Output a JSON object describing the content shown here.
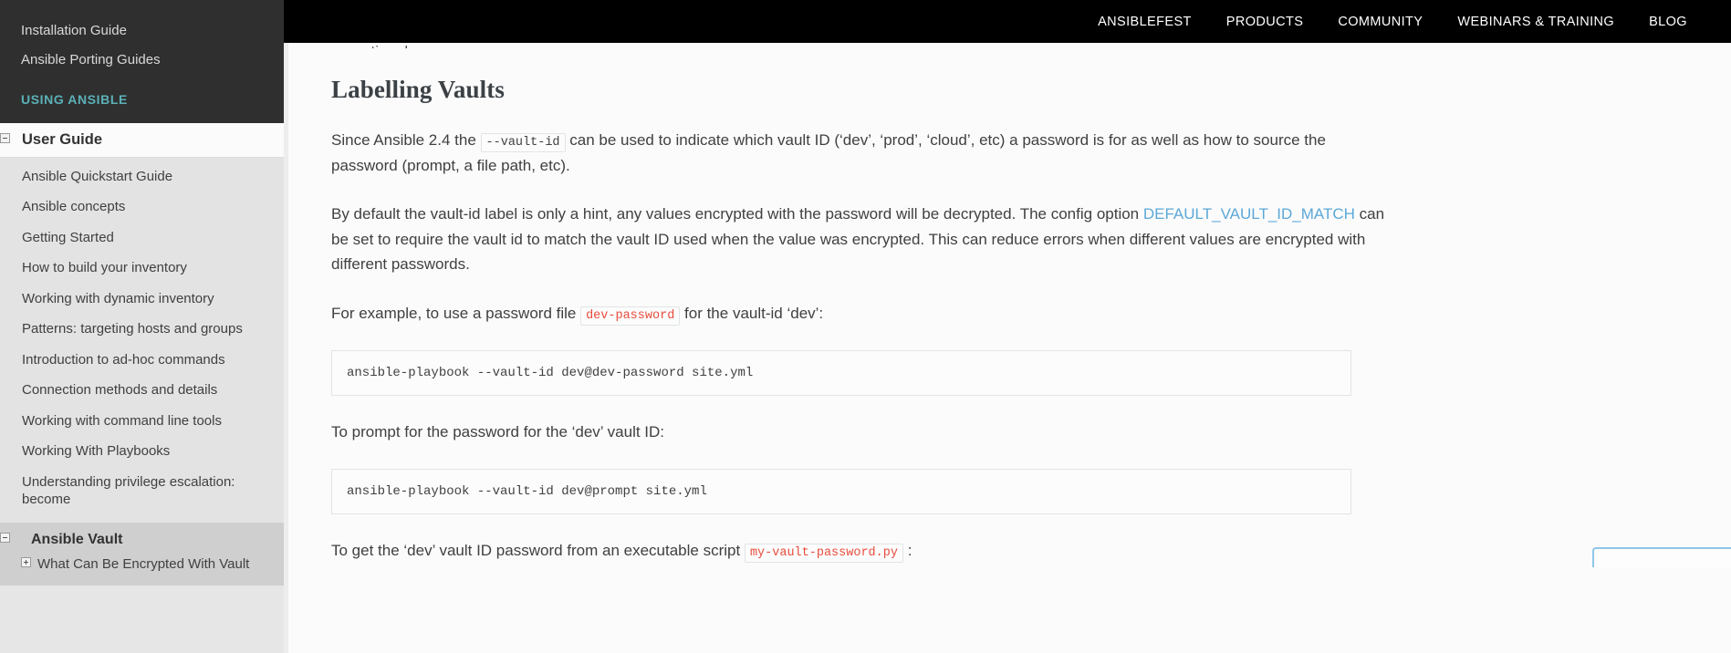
{
  "topnav": {
    "items": [
      {
        "label": "ANSIBLEFEST"
      },
      {
        "label": "PRODUCTS"
      },
      {
        "label": "COMMUNITY"
      },
      {
        "label": "WEBINARS & TRAINING"
      },
      {
        "label": "BLOG"
      }
    ],
    "background_color": "#000000",
    "text_color": "#ffffff"
  },
  "sidebar": {
    "top_links": [
      {
        "label": "Installation Guide"
      },
      {
        "label": "Ansible Porting Guides"
      }
    ],
    "caption": "USING ANSIBLE",
    "caption_color": "#5bb1b8",
    "user_guide": {
      "label": "User Guide",
      "expander": "minus"
    },
    "user_guide_items": [
      {
        "label": "Ansible Quickstart Guide"
      },
      {
        "label": "Ansible concepts"
      },
      {
        "label": "Getting Started"
      },
      {
        "label": "How to build your inventory"
      },
      {
        "label": "Working with dynamic inventory"
      },
      {
        "label": "Patterns: targeting hosts and groups"
      },
      {
        "label": "Introduction to ad-hoc commands"
      },
      {
        "label": "Connection methods and details"
      },
      {
        "label": "Working with command line tools"
      },
      {
        "label": "Working With Playbooks"
      },
      {
        "label": "Understanding privilege escalation: become"
      }
    ],
    "vault": {
      "label": "Ansible Vault",
      "expander": "minus"
    },
    "vault_items": [
      {
        "label": "What Can Be Encrypted With Vault",
        "expander": "plus"
      }
    ]
  },
  "content": {
    "clipped_line": "operational use.",
    "heading": "Labelling Vaults",
    "p1_a": "Since Ansible 2.4 the ",
    "p1_code": "--vault-id",
    "p1_b": " can be used to indicate which vault ID (‘dev’, ‘prod’, ‘cloud’, etc) a password is for as well as how to source the password (prompt, a file path, etc).",
    "p2_a": "By default the vault-id label is only a hint, any values encrypted with the password will be decrypted. The config option ",
    "p2_link": "DEFAULT_VAULT_ID_MATCH",
    "p2_b": " can be set to require the vault id to match the vault ID used when the value was encrypted. This can reduce errors when different values are encrypted with different passwords.",
    "p3_a": "For example, to use a password file ",
    "p3_code": "dev-password",
    "p3_b": " for the vault-id ‘dev’:",
    "code1": "ansible-playbook --vault-id dev@dev-password site.yml",
    "p4": "To prompt for the password for the ‘dev’ vault ID:",
    "code2": "ansible-playbook --vault-id dev@prompt site.yml",
    "p5_a": "To get the ‘dev’ vault ID password from an executable script ",
    "p5_code": "my-vault-password.py",
    "p5_b": " :",
    "link_color": "#5ba8d8",
    "literal_color": "#e74c3c"
  }
}
